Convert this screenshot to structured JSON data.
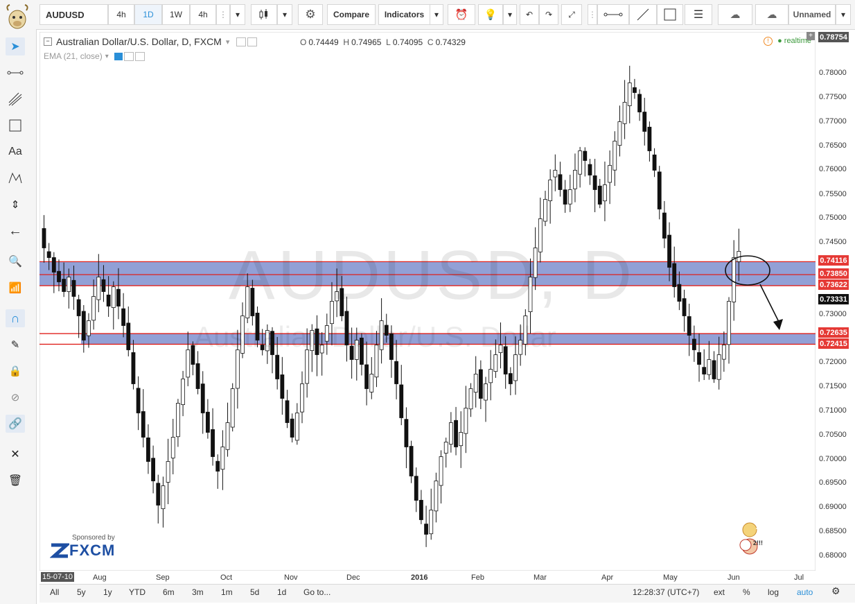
{
  "toolbar": {
    "symbol": "AUDUSD",
    "interval_4h": "4h",
    "interval_1d": "1D",
    "interval_1w": "1W",
    "interval_4h_b": "4h",
    "compare": "Compare",
    "indicators": "Indicators",
    "layout_name": "Unnamed"
  },
  "legend": {
    "title": "Australian Dollar/U.S. Dollar, D, FXCM",
    "o_label": "O",
    "o": "0.74449",
    "h_label": "H",
    "h": "0.74965",
    "l_label": "L",
    "l": "0.74095",
    "c_label": "C",
    "c": "0.74329",
    "ema": "EMA (21, close)",
    "realtime": "realtime"
  },
  "watermark": {
    "line1": "AUDUSD, D",
    "line2": "Australian Dollar/U.S. Dollar"
  },
  "price_axis": {
    "labels": [
      "0.78000",
      "0.77500",
      "0.77000",
      "0.76500",
      "0.76000",
      "0.75500",
      "0.75000",
      "0.74500",
      "0.73000",
      "0.72000",
      "0.71500",
      "0.71000",
      "0.70500",
      "0.70000",
      "0.69500",
      "0.69000",
      "0.68500",
      "0.68000"
    ],
    "top_label": "0.78754",
    "badges": [
      {
        "text": "0.74116",
        "color": "#e53935"
      },
      {
        "text": "0.73850",
        "color": "#e53935"
      },
      {
        "text": "0.73622",
        "color": "#e53935"
      },
      {
        "text": "0.73331",
        "color": "#111111"
      },
      {
        "text": "0.72635",
        "color": "#e53935"
      },
      {
        "text": "0.72415",
        "color": "#e53935"
      }
    ]
  },
  "time_axis": [
    "15-07-10",
    "Aug",
    "Sep",
    "Oct",
    "Nov",
    "Dec",
    "2016",
    "Feb",
    "Mar",
    "Apr",
    "May",
    "Jun",
    "Jul"
  ],
  "bottom_bar": {
    "ranges": [
      "All",
      "5y",
      "1y",
      "YTD",
      "6m",
      "3m",
      "1m",
      "5d",
      "1d"
    ],
    "goto": "Go to...",
    "time": "12:28:37 (UTC+7)",
    "ext": "ext",
    "percent": "%",
    "log": "log",
    "auto": "auto"
  },
  "sponsor": {
    "label": "Sponsored by",
    "brand": "FXCM"
  },
  "colors": {
    "band_fill": "#7f8fcf",
    "band_line": "#e0201c",
    "accent": "#2a8fd8"
  },
  "chart_data": {
    "type": "candlestick",
    "symbol": "AUDUSD",
    "ylim": [
      0.6775,
      0.7885
    ],
    "zones": [
      {
        "top": 0.74116,
        "bottom": 0.73622,
        "mid": 0.7385
      },
      {
        "top": 0.72635,
        "bottom": 0.72415
      }
    ],
    "last_price": 0.73331,
    "close_series": [
      0.744,
      0.742,
      0.739,
      0.737,
      0.735,
      0.738,
      0.734,
      0.73,
      0.725,
      0.729,
      0.734,
      0.738,
      0.735,
      0.732,
      0.736,
      0.732,
      0.728,
      0.723,
      0.716,
      0.71,
      0.705,
      0.7,
      0.696,
      0.691,
      0.695,
      0.7,
      0.705,
      0.712,
      0.717,
      0.723,
      0.72,
      0.715,
      0.71,
      0.706,
      0.701,
      0.698,
      0.703,
      0.708,
      0.715,
      0.723,
      0.73,
      0.736,
      0.73,
      0.725,
      0.723,
      0.727,
      0.722,
      0.717,
      0.713,
      0.708,
      0.705,
      0.71,
      0.716,
      0.723,
      0.727,
      0.722,
      0.724,
      0.728,
      0.733,
      0.735,
      0.73,
      0.724,
      0.721,
      0.725,
      0.72,
      0.715,
      0.718,
      0.724,
      0.729,
      0.726,
      0.721,
      0.716,
      0.709,
      0.703,
      0.697,
      0.692,
      0.688,
      0.685,
      0.69,
      0.696,
      0.701,
      0.704,
      0.708,
      0.703,
      0.706,
      0.711,
      0.715,
      0.718,
      0.713,
      0.716,
      0.719,
      0.722,
      0.724,
      0.718,
      0.716,
      0.722,
      0.725,
      0.73,
      0.738,
      0.744,
      0.75,
      0.754,
      0.758,
      0.76,
      0.756,
      0.753,
      0.756,
      0.76,
      0.764,
      0.762,
      0.759,
      0.756,
      0.753,
      0.757,
      0.761,
      0.766,
      0.77,
      0.774,
      0.778,
      0.776,
      0.772,
      0.768,
      0.764,
      0.76,
      0.752,
      0.746,
      0.74,
      0.736,
      0.733,
      0.73,
      0.726,
      0.723,
      0.72,
      0.718,
      0.721,
      0.717,
      0.722,
      0.724,
      0.733,
      0.742,
      0.7433
    ]
  }
}
